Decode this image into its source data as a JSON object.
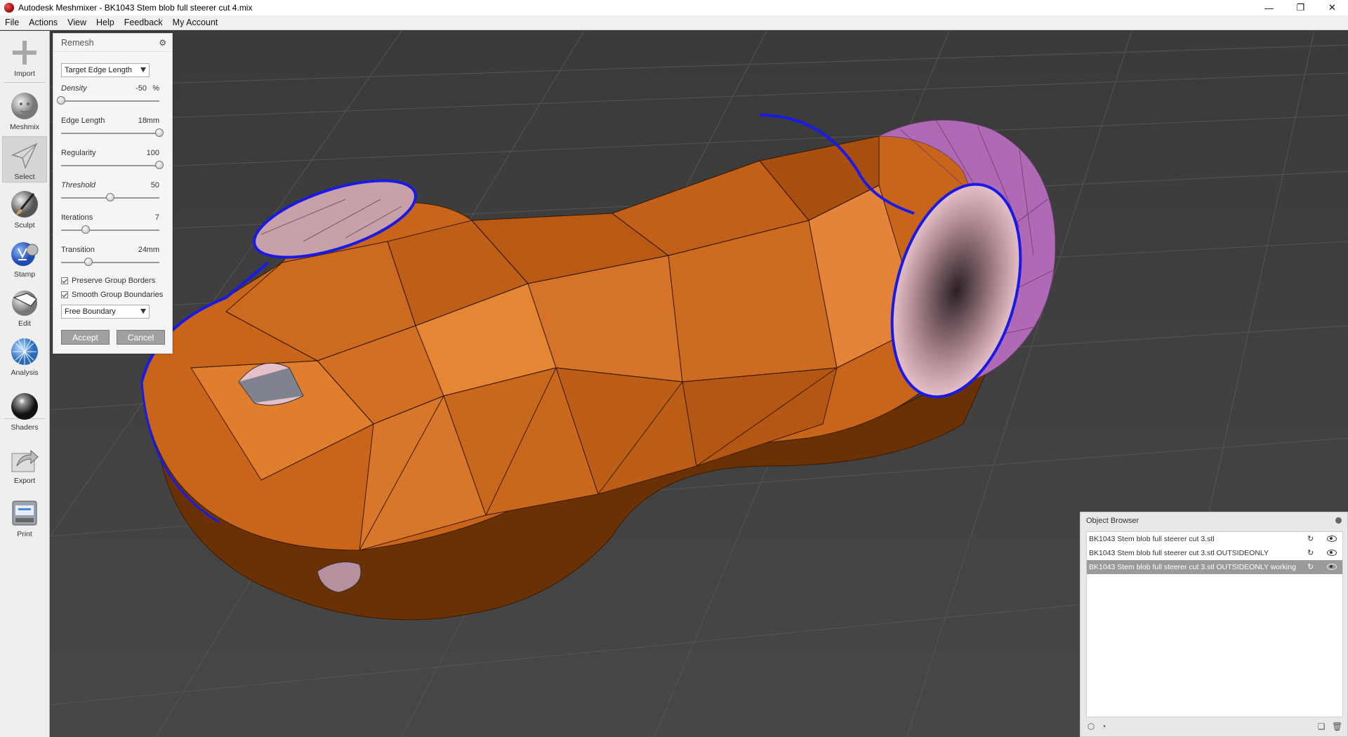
{
  "window": {
    "title": "Autodesk Meshmixer - BK1043 Stem blob full steerer cut 4.mix",
    "minimize": "—",
    "restore": "❐",
    "close": "✕"
  },
  "menu": [
    "File",
    "Actions",
    "View",
    "Help",
    "Feedback",
    "My Account"
  ],
  "toolbar": {
    "items": [
      {
        "label": "Import",
        "icon": "plus-icon"
      },
      {
        "label": "Meshmix",
        "icon": "head-icon"
      },
      {
        "label": "Select",
        "icon": "arrow-icon"
      },
      {
        "label": "Sculpt",
        "icon": "brush-icon"
      },
      {
        "label": "Stamp",
        "icon": "stamp-icon"
      },
      {
        "label": "Edit",
        "icon": "edit-sphere-icon"
      },
      {
        "label": "Analysis",
        "icon": "analysis-sphere-icon"
      },
      {
        "label": "Shaders",
        "icon": "shader-sphere-icon"
      },
      {
        "label": "Export",
        "icon": "export-icon"
      },
      {
        "label": "Print",
        "icon": "printer-icon"
      }
    ],
    "active": "Select"
  },
  "remesh": {
    "title": "Remesh",
    "mode": "Target Edge Length",
    "params": [
      {
        "label": "Density",
        "value": "-50",
        "unit": "%",
        "italic": true,
        "fraction": 0.0
      },
      {
        "label": "Edge Length",
        "value": "18",
        "unit": "mm",
        "italic": false,
        "fraction": 1.0
      },
      {
        "label": "Regularity",
        "value": "100",
        "unit": "",
        "italic": false,
        "fraction": 1.0
      },
      {
        "label": "Threshold",
        "value": "50",
        "unit": "",
        "italic": true,
        "fraction": 0.5
      },
      {
        "label": "Iterations",
        "value": "7",
        "unit": "",
        "italic": false,
        "fraction": 0.25
      },
      {
        "label": "Transition",
        "value": "24",
        "unit": "mm",
        "italic": false,
        "fraction": 0.28
      }
    ],
    "preserve_group_borders": "Preserve Group Borders",
    "smooth_group_boundaries": "Smooth Group Boundaries",
    "boundary_mode": "Free Boundary",
    "accept": "Accept",
    "cancel": "Cancel"
  },
  "object_browser": {
    "title": "Object Browser",
    "objects": [
      {
        "name": "BK1043 Stem blob full steerer cut 3.stl",
        "selected": false
      },
      {
        "name": "BK1043 Stem blob full steerer cut 3.stl OUTSIDEONLY",
        "selected": false
      },
      {
        "name": "BK1043 Stem blob full steerer cut 3.stl OUTSIDEONLY working",
        "selected": true
      }
    ]
  },
  "colors": {
    "mesh_orange": "#d9741f",
    "mesh_dark": "#8a4409",
    "selection_purple": "#b06ab5",
    "boundary_blue": "#1a1ae6",
    "viewport_bg": "#3f3f3f"
  }
}
